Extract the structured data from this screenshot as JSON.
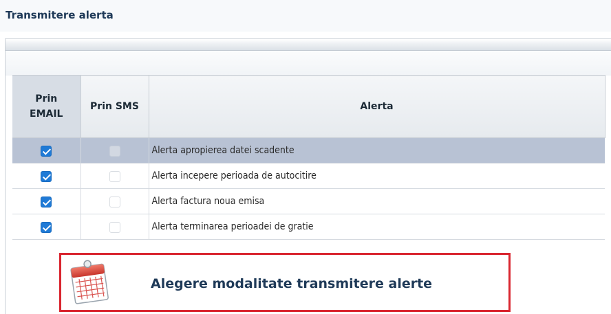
{
  "section": {
    "title": "Transmitere alerta"
  },
  "table": {
    "headers": {
      "email": "Prin EMAIL",
      "sms": "Prin SMS",
      "alert": "Alerta"
    },
    "rows": [
      {
        "label": "Alerta apropierea datei scadente",
        "email": true,
        "sms": false,
        "selected": true
      },
      {
        "label": "Alerta incepere perioada de autocitire",
        "email": true,
        "sms": false,
        "selected": false
      },
      {
        "label": "Alerta factura noua emisa",
        "email": true,
        "sms": false,
        "selected": false
      },
      {
        "label": "Alerta terminarea perioadei de gratie",
        "email": true,
        "sms": false,
        "selected": false
      }
    ]
  },
  "action": {
    "label": "Alegere modalitate transmitere alerte",
    "icon": "calendar-icon"
  },
  "colors": {
    "accent_blue": "#1f7ad6",
    "highlight_red": "#d9252f",
    "title_text": "#1f3a58",
    "selected_row": "#b8c2d4"
  }
}
